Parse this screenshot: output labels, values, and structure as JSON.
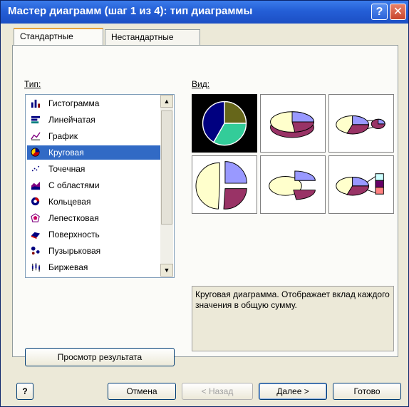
{
  "window": {
    "title": "Мастер диаграмм (шаг 1 из 4): тип диаграммы",
    "help_glyph": "?",
    "close_glyph": "✕"
  },
  "tabs": [
    {
      "label": "Стандартные",
      "active": true
    },
    {
      "label": "Нестандартные",
      "active": false
    }
  ],
  "type_label": "Тип:",
  "view_label": "Вид:",
  "chart_types": [
    {
      "label": "Гистограмма",
      "icon": "column-chart-icon"
    },
    {
      "label": "Линейчатая",
      "icon": "bar-chart-icon"
    },
    {
      "label": "График",
      "icon": "line-chart-icon"
    },
    {
      "label": "Круговая",
      "icon": "pie-chart-icon",
      "selected": true
    },
    {
      "label": "Точечная",
      "icon": "scatter-chart-icon"
    },
    {
      "label": "С областями",
      "icon": "area-chart-icon"
    },
    {
      "label": "Кольцевая",
      "icon": "doughnut-chart-icon"
    },
    {
      "label": "Лепестковая",
      "icon": "radar-chart-icon"
    },
    {
      "label": "Поверхность",
      "icon": "surface-chart-icon"
    },
    {
      "label": "Пузырьковая",
      "icon": "bubble-chart-icon"
    },
    {
      "label": "Биржевая",
      "icon": "stock-chart-icon"
    }
  ],
  "subtypes": [
    {
      "icon": "pie-flat-icon",
      "selected": true
    },
    {
      "icon": "pie-3d-icon"
    },
    {
      "icon": "pie-of-pie-icon"
    },
    {
      "icon": "exploded-pie-icon"
    },
    {
      "icon": "exploded-pie-3d-icon"
    },
    {
      "icon": "bar-of-pie-icon"
    }
  ],
  "description": "Круговая диаграмма. Отображает вклад каждого значения в общую сумму.",
  "buttons": {
    "preview": "Просмотр результата",
    "help": "?",
    "cancel": "Отмена",
    "back": "< Назад",
    "next": "Далее >",
    "finish": "Готово"
  },
  "colors": {
    "slice_purple": "#9999ff",
    "slice_wine": "#993366",
    "slice_cream": "#ffffcc",
    "slice_teal": "#33cc99",
    "slice_olive": "#66661a",
    "slice_navy": "#000080",
    "selection": "#316ac5"
  }
}
